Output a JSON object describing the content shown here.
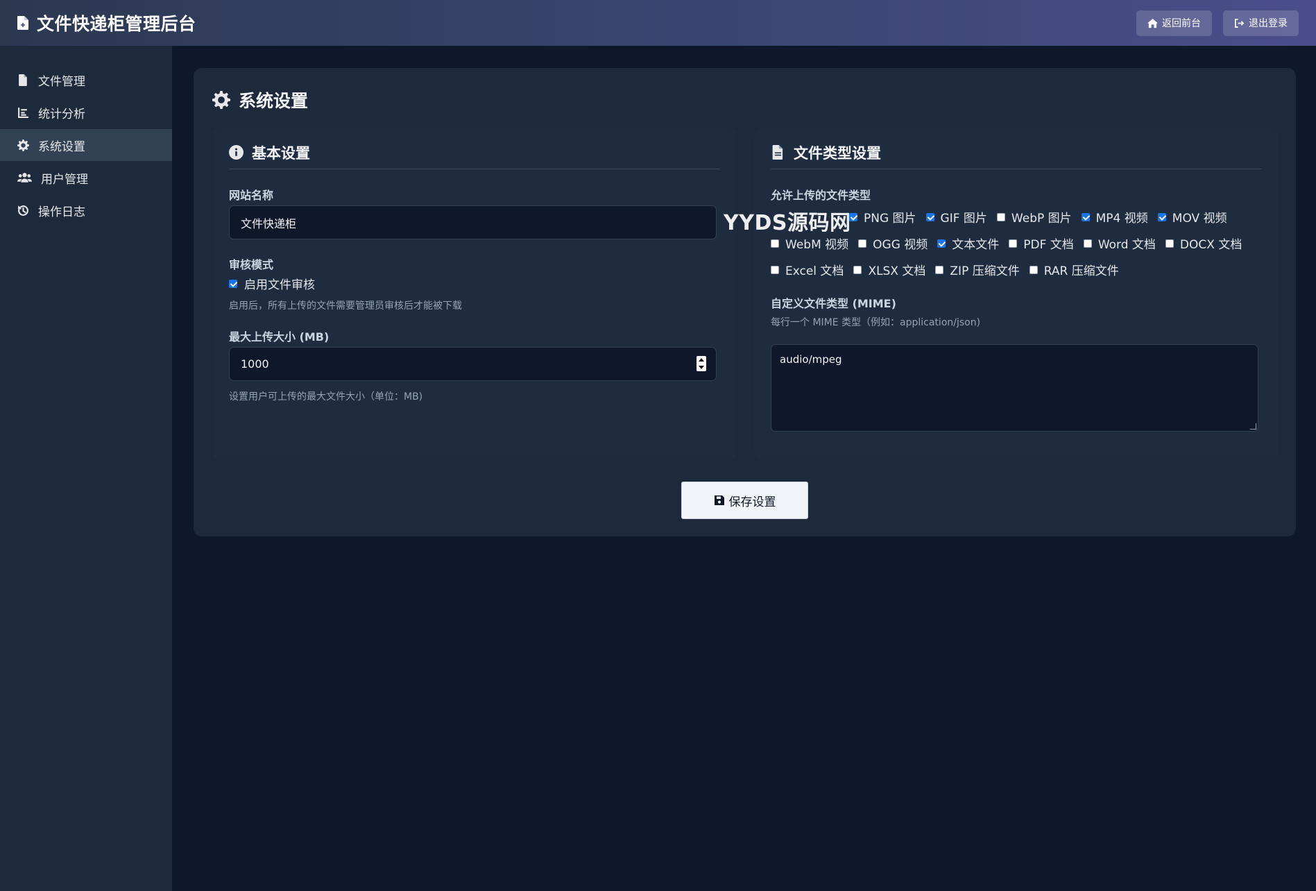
{
  "header": {
    "title": "文件快递柜管理后台",
    "back_label": "返回前台",
    "logout_label": "退出登录",
    "logo_icon": "file-icon"
  },
  "sidebar": {
    "items": [
      {
        "label": "文件管理",
        "icon": "file-icon"
      },
      {
        "label": "统计分析",
        "icon": "chart-icon"
      },
      {
        "label": "系统设置",
        "icon": "gear-icon",
        "active": true
      },
      {
        "label": "用户管理",
        "icon": "users-icon"
      },
      {
        "label": "操作日志",
        "icon": "history-icon"
      }
    ]
  },
  "main": {
    "title": "系统设置",
    "basic": {
      "title": "基本设置",
      "site_name_label": "网站名称",
      "site_name_value": "文件快递柜",
      "review_label": "审核模式",
      "review_checkbox_label": "启用文件审核",
      "review_checked": true,
      "review_hint": "启用后，所有上传的文件需要管理员审核后才能被下载",
      "max_size_label": "最大上传大小 (MB)",
      "max_size_value": "1000",
      "max_size_hint": "设置用户可上传的最大文件大小（单位：MB)"
    },
    "filetypes": {
      "title": "文件类型设置",
      "allowed_label": "允许上传的文件类型",
      "types": [
        {
          "label": "PNG 图片",
          "checked": true
        },
        {
          "label": "GIF 图片",
          "checked": true
        },
        {
          "label": "WebP 图片",
          "checked": false
        },
        {
          "label": "MP4 视频",
          "checked": true
        },
        {
          "label": "MOV 视频",
          "checked": true
        },
        {
          "label": "WebM 视频",
          "checked": false
        },
        {
          "label": "OGG 视频",
          "checked": false
        },
        {
          "label": "文本文件",
          "checked": true
        },
        {
          "label": "PDF 文档",
          "checked": false
        },
        {
          "label": "Word 文档",
          "checked": false
        },
        {
          "label": "DOCX 文档",
          "checked": false
        },
        {
          "label": "Excel 文档",
          "checked": false
        },
        {
          "label": "XLSX 文档",
          "checked": false
        },
        {
          "label": "ZIP 压缩文件",
          "checked": false
        },
        {
          "label": "RAR 压缩文件",
          "checked": false
        }
      ],
      "mime_label": "自定义文件类型 (MIME)",
      "mime_hint": "每行一个 MIME 类型（例如：application/json)",
      "mime_value": "audio/mpeg"
    },
    "save_label": "保存设置"
  },
  "watermark": "YYDS源码网",
  "colors": {
    "background": "#0f172a",
    "sidebar": "#1e293b",
    "card": "#1e293b",
    "accent": "#1a73e8"
  }
}
